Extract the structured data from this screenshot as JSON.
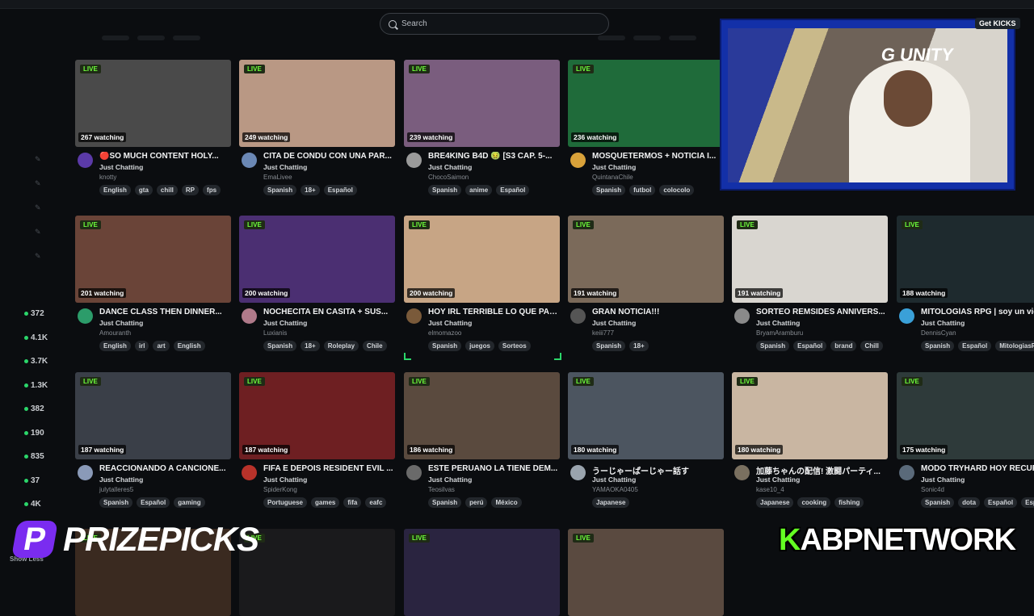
{
  "search": {
    "placeholder": "Search"
  },
  "overlay": {
    "get_kicks": "Get KICKS",
    "prizepicks": "PRIZEPICKS",
    "network_k": "K",
    "network_rest": "ABPNETWORK"
  },
  "sidebar": {
    "counts": [
      "372",
      "4.1K",
      "3.7K",
      "1.3K",
      "382",
      "190",
      "835",
      "37",
      "4K"
    ],
    "show_less": "Show Less"
  },
  "live_badge": "LIVE",
  "streams": [
    {
      "watching": "267 watching",
      "title": "🔴SO MUCH CONTENT HOLY...",
      "category": "Just Chatting",
      "channel": "knotty",
      "tags": [
        "English",
        "gta",
        "chill",
        "RP",
        "fps"
      ],
      "thumb": "#4a4a4a",
      "avatar": "#5b3aa8"
    },
    {
      "watching": "249 watching",
      "title": "CITA DE CONDU CON UNA PAR...",
      "category": "Just Chatting",
      "channel": "EmaLivee",
      "tags": [
        "Spanish",
        "18+",
        "Español"
      ],
      "thumb": "#b99884",
      "avatar": "#6b88b5"
    },
    {
      "watching": "239 watching",
      "title": "BRE4KING B4D 🤢 [S3 CAP. 5-...",
      "category": "Just Chatting",
      "channel": "ChocoSaimon",
      "tags": [
        "Spanish",
        "anime",
        "Español"
      ],
      "thumb": "#7a5d7e",
      "avatar": "#9a9a9a"
    },
    {
      "watching": "236 watching",
      "title": "MOSQUETERMOS + NOTICIA I...",
      "category": "Just Chatting",
      "channel": "QuintanaChile",
      "tags": [
        "Spanish",
        "futbol",
        "colocolo"
      ],
      "thumb": "#1f6b3a",
      "avatar": "#d9a23a"
    },
    {
      "watching": "201 watching",
      "title": "DANCE CLASS THEN DINNER...",
      "category": "Just Chatting",
      "channel": "Amouranth",
      "tags": [
        "English",
        "irl",
        "art",
        "English"
      ],
      "thumb": "#6a4438",
      "avatar": "#2c9c6a"
    },
    {
      "watching": "200 watching",
      "title": "NOCHECITA EN CASITA + SUS...",
      "category": "Just Chatting",
      "channel": "Luxianis",
      "tags": [
        "Spanish",
        "18+",
        "Roleplay",
        "Chile"
      ],
      "thumb": "#4b2f72",
      "avatar": "#b07a8a"
    },
    {
      "watching": "200 watching",
      "title": "HOY IRL TERRIBLE LO QUE PAS...",
      "category": "Just Chatting",
      "channel": "elmomazoo",
      "tags": [
        "Spanish",
        "juegos",
        "Sorteos"
      ],
      "thumb": "#c7a585",
      "avatar": "#7a5a3a"
    },
    {
      "watching": "191 watching",
      "title": "GRAN NOTICIA!!!",
      "category": "Just Chatting",
      "channel": "keiii777",
      "tags": [
        "Spanish",
        "18+"
      ],
      "thumb": "#7b6a5a",
      "avatar": "#555555"
    },
    {
      "watching": "191 watching",
      "title": "SORTEO REMSIDES ANNIVERS...",
      "category": "Just Chatting",
      "channel": "BryamAramburu",
      "tags": [
        "Spanish",
        "Español",
        "brand",
        "Chill"
      ],
      "thumb": "#d9d6d0",
      "avatar": "#8a8a8a"
    },
    {
      "watching": "188 watching",
      "title": "MITOLOGÍAS RPG | soy un vici",
      "category": "Just Chatting",
      "channel": "DennisCyan",
      "tags": [
        "Spanish",
        "Español",
        "MitologiasR"
      ],
      "thumb": "#1e2a2e",
      "avatar": "#3aa0d8"
    },
    {
      "watching": "187 watching",
      "title": "REACCIONANDO A CANCIONE...",
      "category": "Just Chatting",
      "channel": "julytalleres5",
      "tags": [
        "Spanish",
        "Español",
        "gaming"
      ],
      "thumb": "#3a3f48",
      "avatar": "#8a9ab8"
    },
    {
      "watching": "187 watching",
      "title": "FIFA E DEPOIS RESIDENT EVIL ...",
      "category": "Just Chatting",
      "channel": "SpiderKong",
      "tags": [
        "Portuguese",
        "games",
        "fifa",
        "eafc"
      ],
      "thumb": "#6e1f22",
      "avatar": "#b8322a"
    },
    {
      "watching": "186 watching",
      "title": "ESTE PERUANO LA TIENE DEM...",
      "category": "Just Chatting",
      "channel": "Teosilvas",
      "tags": [
        "Spanish",
        "perú",
        "México"
      ],
      "thumb": "#5a4a3e",
      "avatar": "#6a6a6a"
    },
    {
      "watching": "180 watching",
      "title": "うーじゃーぱーじゃー話す",
      "category": "Just Chatting",
      "channel": "YAMAOKA0405",
      "tags": [
        "Japanese"
      ],
      "thumb": "#4c5560",
      "avatar": "#9aa4ae"
    },
    {
      "watching": "180 watching",
      "title": "加藤ちゃんの配信! 激闘パーティ...",
      "category": "Just Chatting",
      "channel": "kase10_4",
      "tags": [
        "Japanese",
        "cooking",
        "fishing"
      ],
      "thumb": "#c9b6a2",
      "avatar": "#7a7060"
    },
    {
      "watching": "175 watching",
      "title": "MODO TRYHARD HOY RECUPE",
      "category": "Just Chatting",
      "channel": "Sonic4d",
      "tags": [
        "Spanish",
        "dota",
        "Español",
        "Español"
      ],
      "thumb": "#2e3a3a",
      "avatar": "#5a6a7a"
    },
    {
      "watching": "",
      "title": "",
      "category": "",
      "channel": "",
      "tags": [],
      "thumb": "#3a2a20",
      "avatar": "#333"
    },
    {
      "watching": "",
      "title": "",
      "category": "",
      "channel": "",
      "tags": [],
      "thumb": "#1a1a1c",
      "avatar": "#333"
    },
    {
      "watching": "",
      "title": "",
      "category": "",
      "channel": "",
      "tags": [],
      "thumb": "#2a2440",
      "avatar": "#333"
    },
    {
      "watching": "",
      "title": "",
      "category": "",
      "channel": "",
      "tags": [],
      "thumb": "#5a4a40",
      "avatar": "#333"
    }
  ]
}
